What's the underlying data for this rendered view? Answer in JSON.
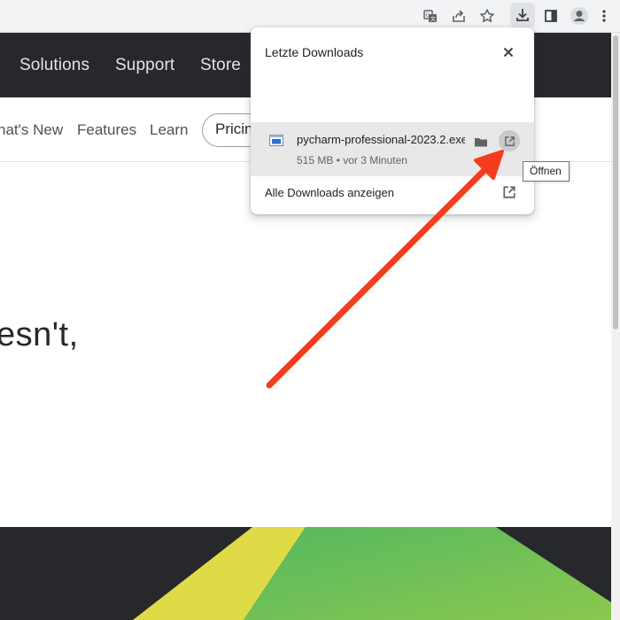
{
  "browser": {
    "toolbar_icons": [
      "translate-icon",
      "share-icon",
      "bookmark-star-icon",
      "download-icon",
      "side-panel-icon",
      "profile-icon",
      "more-menu-icon"
    ]
  },
  "site_nav": {
    "items": [
      "Solutions",
      "Support",
      "Store"
    ]
  },
  "sub_nav": {
    "whats_new": "hat's New",
    "features": "Features",
    "learn": "Learn",
    "pricing": "Pricing"
  },
  "main": {
    "headline": "esn't,"
  },
  "downloads_popup": {
    "title": "Letzte Downloads",
    "file_name": "pycharm-professional-2023.2.exe",
    "file_meta": "515 MB • vor 3 Minuten",
    "show_all": "Alle Downloads anzeigen",
    "tooltip": "Öffnen"
  },
  "colors": {
    "nav_bg": "#27282c",
    "annotation_arrow": "#f63c1d",
    "hero_yellow": "#dedb47",
    "hero_green": "#5ebc5e"
  }
}
